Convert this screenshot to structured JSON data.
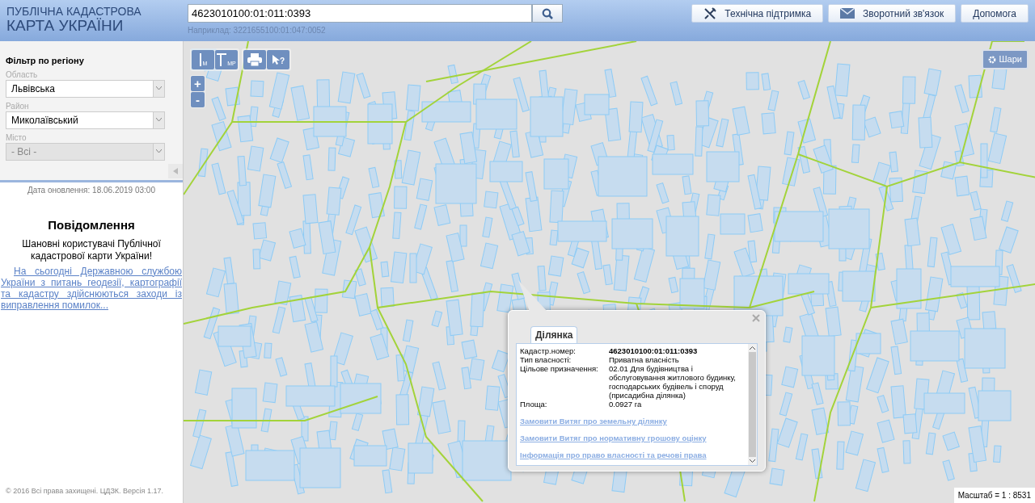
{
  "header": {
    "title_top": "ПУБЛІЧНА КАДАСТРОВА",
    "title_main": "КАРТА УКРАЇНИ",
    "search": {
      "value": "4623010100:01:011:0393",
      "hint": "Наприклад: 3221655100:01:047:0052"
    },
    "buttons": [
      {
        "kind": "support",
        "label": "Технічна підтримка"
      },
      {
        "kind": "feedback",
        "label": "Зворотний зв'язок"
      },
      {
        "kind": "help",
        "label": "Допомога"
      }
    ]
  },
  "sidebar": {
    "filter_title": "Фільтр по регіону",
    "fields": [
      {
        "label": "Область",
        "value": "Львівська",
        "disabled": false
      },
      {
        "label": "Район",
        "value": "Миколаївський",
        "disabled": false
      },
      {
        "label": "Місто",
        "value": "- Всі -",
        "disabled": true
      }
    ],
    "update_date": "Дата оновлення: 18.06.2019 03:00",
    "notice": {
      "title": "Повідомлення",
      "greeting": "Шановні користувачі Публічної кадастрової карти України!",
      "link": "На сьогодні Державною службою України з питань геодезії, картографії та кадастру здійснюються заходи із виправлення помилок..."
    },
    "footer": "© 2016 Всі права захищені. ЦДЗК. Версія 1.17."
  },
  "map": {
    "tools": [
      {
        "kind": "ruler",
        "sub": "M"
      },
      {
        "kind": "area",
        "sub": "MP"
      },
      {
        "kind": "print"
      },
      {
        "kind": "identify",
        "sub": "?"
      }
    ],
    "zoom": [
      "+",
      "-"
    ],
    "layers_button": "Шари",
    "scale": "Масштаб = 1 : 8531"
  },
  "popup": {
    "tabs": [
      {
        "label": "Ділянка",
        "selected": true
      }
    ],
    "rows": [
      {
        "label": "Кадастр.номер:",
        "value": "4623010100:01:011:0393",
        "bold": true
      },
      {
        "label": "Тип власності:",
        "value": "Приватна власність",
        "bold": false
      },
      {
        "label": "Цільове призначення:",
        "value": "02.01 Для будівництва і обслуговування житлового будинку, господарських будівель і споруд (присадибна ділянка)",
        "bold": false
      },
      {
        "label": "Площа:",
        "value": "0.0927 га",
        "bold": false
      }
    ],
    "links": [
      "Замовити Витяг про земельну ділянку",
      "Замовити Витяг про нормативну грошову оцінку",
      "Інформація про право власності та речові права"
    ]
  }
}
